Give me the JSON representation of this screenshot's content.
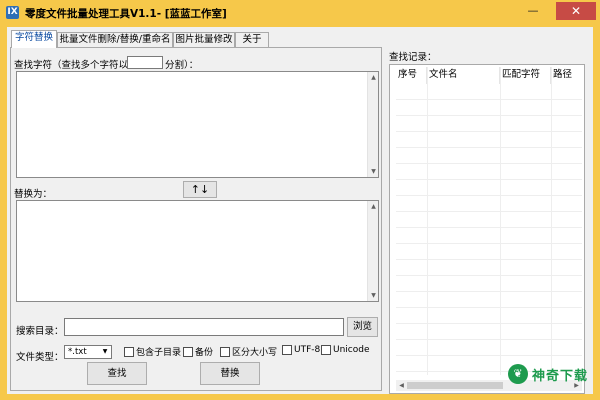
{
  "window": {
    "icon_text": "IX",
    "title": "零度文件批量处理工具V1.1- [蓝蓝工作室]",
    "minimize_glyph": "—",
    "close_glyph": "✕"
  },
  "tabs": [
    {
      "label": "字符替换",
      "active": true
    },
    {
      "label": "批量文件删除/替换/重命名",
      "active": false
    },
    {
      "label": "图片批量修改",
      "active": false
    },
    {
      "label": "关于",
      "active": false
    }
  ],
  "find": {
    "label_prefix": "查找字符（查找多个字符以",
    "separator_value": "",
    "label_suffix": "分割）："
  },
  "swap_button": "↑↓",
  "replace_label": "替换为：",
  "search_dir": {
    "label": "搜索目录：",
    "value": "",
    "browse_label": "浏览"
  },
  "file_type": {
    "label": "文件类型：",
    "selected": "*.txt"
  },
  "options": [
    {
      "label": "包含子目录",
      "checked": false
    },
    {
      "label": "备份",
      "checked": false
    },
    {
      "label": "区分大小写",
      "checked": false
    },
    {
      "label": "UTF-8",
      "checked": false
    },
    {
      "label": "Unicode",
      "checked": false
    }
  ],
  "actions": {
    "find_label": "查找",
    "replace_label": "替换"
  },
  "records": {
    "label": "查找记录：",
    "columns": [
      "序号",
      "文件名",
      "匹配字符",
      "路径"
    ]
  },
  "watermark": {
    "text": "神奇下载"
  }
}
